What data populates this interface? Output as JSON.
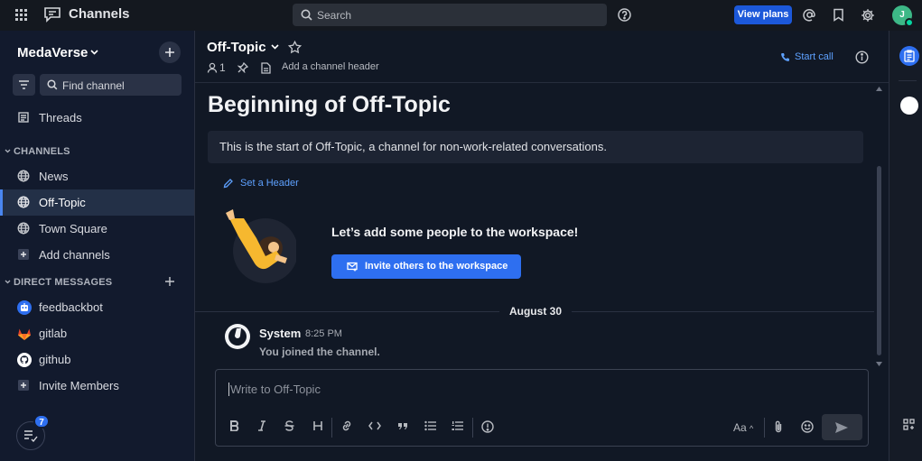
{
  "topbar": {
    "app_title": "Channels",
    "search_placeholder": "Search",
    "view_plans_label": "View plans",
    "avatar_initial": "J"
  },
  "sidebar": {
    "team_name": "MedaVerse",
    "find_channel_label": "Find channel",
    "threads_label": "Threads",
    "channels_header": "CHANNELS",
    "channels": [
      {
        "label": "News",
        "icon": "globe-icon"
      },
      {
        "label": "Off-Topic",
        "icon": "globe-icon",
        "active": true
      },
      {
        "label": "Town Square",
        "icon": "globe-icon"
      },
      {
        "label": "Add channels",
        "icon": "plus-box-icon"
      }
    ],
    "dm_header": "DIRECT MESSAGES",
    "dms": [
      {
        "label": "feedbackbot",
        "icon": "bot-icon"
      },
      {
        "label": "gitlab",
        "icon": "gitlab-icon"
      },
      {
        "label": "github",
        "icon": "github-icon"
      },
      {
        "label": "Invite Members",
        "icon": "plus-box-icon"
      }
    ],
    "badge_count": "7"
  },
  "channel": {
    "name": "Off-Topic",
    "member_count": "1",
    "add_header_label": "Add a channel header",
    "start_call_label": "Start call",
    "intro_title": "Beginning of Off-Topic",
    "intro_text": "This is the start of Off-Topic, a channel for non-work-related conversations.",
    "set_header_label": "Set a Header",
    "add_people_text": "Let’s add some people to the workspace!",
    "invite_button_label": "Invite others to the workspace"
  },
  "messages": {
    "date_separator": "August 30",
    "items": [
      {
        "author": "System",
        "time": "8:25 PM",
        "text": "You joined the channel."
      }
    ]
  },
  "composer": {
    "placeholder": "Write to Off-Topic",
    "font_toggle_label": "Aa"
  },
  "colors": {
    "accent": "#2e6ff0",
    "link": "#5ea1ff",
    "sidebar_bg": "#121a2d",
    "main_bg": "#111825",
    "online": "#06d6a0"
  }
}
